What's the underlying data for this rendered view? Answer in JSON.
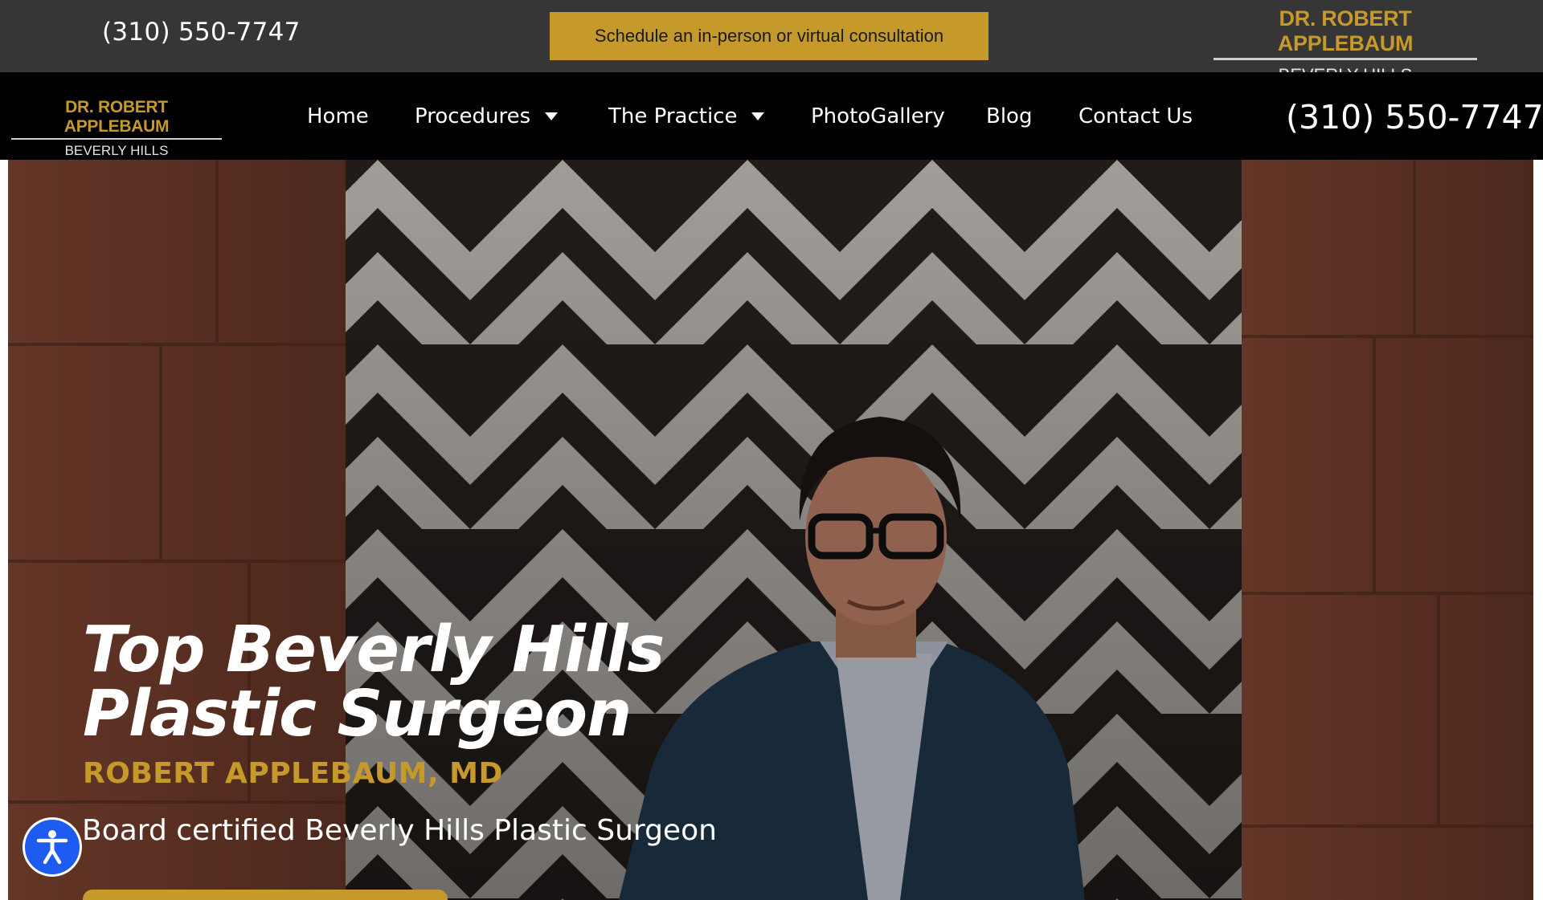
{
  "topbar": {
    "phone": "(310) 550-7747",
    "cta_label": "Schedule an in-person or virtual consultation",
    "logo_line1": "DR. ROBERT APPLEBAUM",
    "logo_line2": "BEVERLY HILLS"
  },
  "nav": {
    "logo_line1": "DR. ROBERT APPLEBAUM",
    "logo_line2": "BEVERLY HILLS",
    "items": [
      {
        "label": "Home",
        "has_dropdown": false
      },
      {
        "label": "Procedures",
        "has_dropdown": true
      },
      {
        "label": "The Practice",
        "has_dropdown": true
      },
      {
        "label": "PhotoGallery",
        "has_dropdown": false
      },
      {
        "label": "Blog",
        "has_dropdown": false
      },
      {
        "label": "Contact Us",
        "has_dropdown": false
      }
    ],
    "phone": "(310) 550-7747"
  },
  "hero": {
    "title_line1": "Top Beverly Hills",
    "title_line2": "Plastic Surgeon",
    "subtitle": "ROBERT APPLEBAUM, MD",
    "description": "Board certified Beverly Hills Plastic Surgeon"
  },
  "icons": {
    "accessibility": "accessibility-icon",
    "dropdown": "caret-down-icon"
  },
  "colors": {
    "accent_gold": "#c69a2a",
    "topbar_bg": "#363636",
    "navbar_bg": "#000000",
    "accessibility_blue": "#1e5bf0"
  }
}
